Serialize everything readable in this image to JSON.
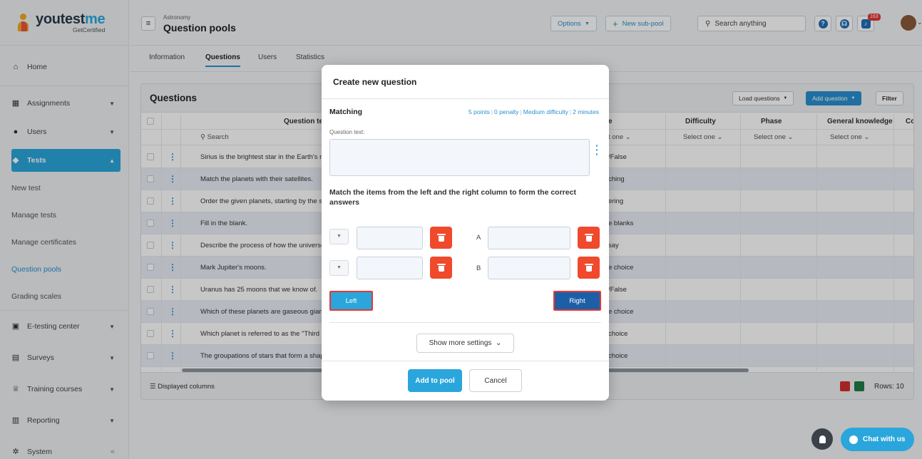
{
  "logo": {
    "brand_a": "youtest",
    "brand_b": "me",
    "sub": "GetCertified"
  },
  "sidebar": {
    "items": [
      {
        "label": "Home",
        "icon": "home-icon"
      },
      {
        "label": "Assignments",
        "icon": "assignments-icon"
      },
      {
        "label": "Users",
        "icon": "users-icon"
      },
      {
        "label": "Tests",
        "icon": "tests-icon"
      }
    ],
    "subitems": [
      "New test",
      "Manage tests",
      "Manage certificates",
      "Question pools",
      "Grading scales"
    ],
    "items2": [
      {
        "label": "E-testing center",
        "icon": "e-testing-icon"
      },
      {
        "label": "Surveys",
        "icon": "surveys-icon"
      },
      {
        "label": "Training courses",
        "icon": "trophy-icon"
      },
      {
        "label": "Reporting",
        "icon": "reporting-icon"
      },
      {
        "label": "System",
        "icon": "gear-icon"
      }
    ],
    "collapse": "«"
  },
  "header": {
    "breadcrumb": "Astronomy",
    "title": "Question pools",
    "options": "Options",
    "new_subpool": "New sub-pool",
    "search_placeholder": "Search anything",
    "notif_count": "163"
  },
  "tabs": [
    "Information",
    "Questions",
    "Users",
    "Statistics"
  ],
  "questions": {
    "title": "Questions",
    "load": "Load questions",
    "add": "Add question",
    "filter": "Filter",
    "columns": {
      "text": "Question text",
      "type": "e",
      "difficulty": "Difficulty",
      "phase": "Phase",
      "knowledge": "General knowledge",
      "extra": "Co"
    },
    "search": "Search",
    "select_one": "Select one",
    "select_part": "t one",
    "rows": [
      {
        "text": "Sirius is the brightest star in the Earth's nigh",
        "type": "/False"
      },
      {
        "text": "Match the planets with their satellites.",
        "type": "ching"
      },
      {
        "text": "Order the given planets, starting by the sma",
        "type": "ering"
      },
      {
        "text": "Fill in the blank.",
        "type": "e blanks"
      },
      {
        "text": "Describe the process of how the universe c",
        "type": "say"
      },
      {
        "text": "Mark Jupiter's moons.",
        "type": "e choice"
      },
      {
        "text": "Uranus has 25 moons that we know of.",
        "type": "/False"
      },
      {
        "text": "Which of these planets are gaseous giants?",
        "type": "e choice"
      },
      {
        "text": "Which planet is referred to as the \"Third roc",
        "type": "choice"
      },
      {
        "text": "The groupations of stars that form a shape",
        "type": "choice"
      }
    ],
    "displayed_columns": "Displayed columns",
    "rows_count": "Rows: 10"
  },
  "modal": {
    "title": "Create new question",
    "type": "Matching",
    "points": "5 points",
    "penalty": "0 penalty",
    "difficulty": "Medium difficulty",
    "time": "2 minutes",
    "question_label": "Question text:",
    "instructions": "Match the items from the left and the right column to form the correct answers",
    "letter_a": "A",
    "letter_b": "B",
    "left": "Left",
    "right": "Right",
    "more_settings": "Show more settings",
    "add": "Add to pool",
    "cancel": "Cancel"
  },
  "chat": {
    "label": "Chat with us"
  }
}
